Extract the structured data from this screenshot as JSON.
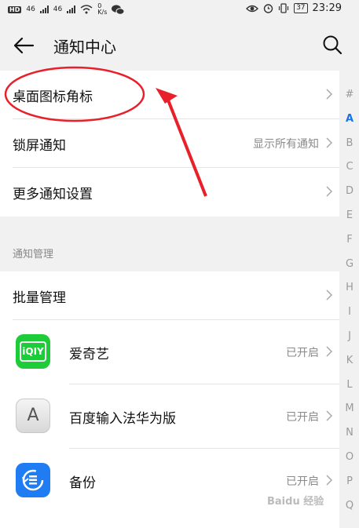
{
  "status_bar": {
    "left_badge": "HD",
    "net1": "46",
    "net2": "46",
    "speed_value": "0",
    "speed_unit": "K/s",
    "battery": "37",
    "time": "23:29"
  },
  "header": {
    "title": "通知中心"
  },
  "settings": [
    {
      "label": "桌面图标角标",
      "value": ""
    },
    {
      "label": "锁屏通知",
      "value": "显示所有通知"
    },
    {
      "label": "更多通知设置",
      "value": ""
    }
  ],
  "section": {
    "label": "通知管理"
  },
  "batch": {
    "label": "批量管理"
  },
  "apps": [
    {
      "label": "爱奇艺",
      "value": "已开启",
      "icon": "iqiyi-icon",
      "color": "#1ecc3a"
    },
    {
      "label": "百度输入法华为版",
      "value": "已开启",
      "icon": "keyboard-a-icon",
      "color": "#e6e6e6"
    },
    {
      "label": "备份",
      "value": "已开启",
      "icon": "backup-icon",
      "color": "#1f7cf2"
    }
  ],
  "index_letters": [
    "#",
    "A",
    "B",
    "C",
    "D",
    "E",
    "F",
    "G",
    "H",
    "I",
    "J",
    "K",
    "L",
    "M",
    "N",
    "O",
    "P",
    "Q"
  ],
  "index_active": "A",
  "iqiyi_logo_text": "iQIY",
  "keyboard_letter": "A",
  "annotation_color": "#e8202a",
  "watermark": "Baidu 经验"
}
